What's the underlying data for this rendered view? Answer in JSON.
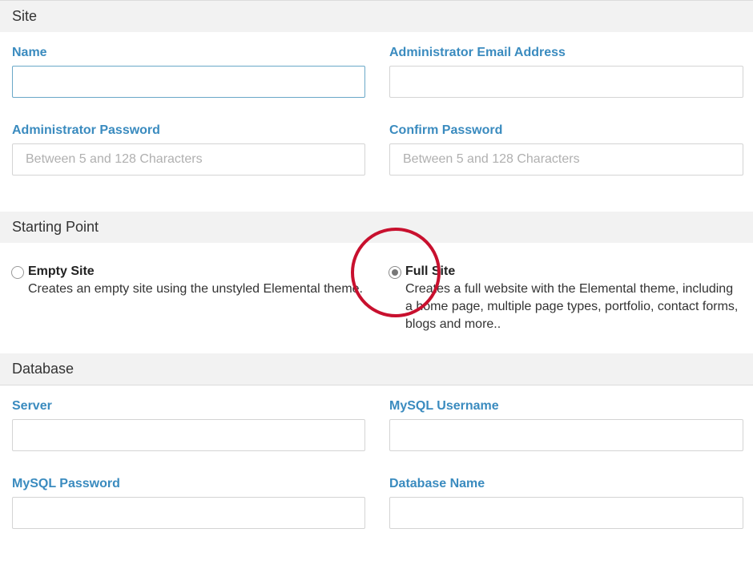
{
  "site": {
    "header": "Site",
    "name_label": "Name",
    "name_value": "",
    "admin_email_label": "Administrator Email Address",
    "admin_email_value": "",
    "admin_password_label": "Administrator Password",
    "admin_password_placeholder": "Between 5 and 128 Characters",
    "confirm_password_label": "Confirm Password",
    "confirm_password_placeholder": "Between 5 and 128 Characters"
  },
  "starting_point": {
    "header": "Starting Point",
    "options": [
      {
        "title": "Empty Site",
        "description": "Creates an empty site using the unstyled Elemental theme.",
        "selected": false
      },
      {
        "title": "Full Site",
        "description": "Creates a full website with the Elemental theme, including a home page, multiple page types, portfolio, contact forms, blogs and more..",
        "selected": true
      }
    ]
  },
  "database": {
    "header": "Database",
    "server_label": "Server",
    "server_value": "",
    "mysql_username_label": "MySQL Username",
    "mysql_username_value": "",
    "mysql_password_label": "MySQL Password",
    "mysql_password_value": "",
    "database_name_label": "Database Name",
    "database_name_value": ""
  },
  "colors": {
    "label": "#3a8bbf",
    "header_bg": "#f2f2f2",
    "annotation": "#c8102e"
  }
}
